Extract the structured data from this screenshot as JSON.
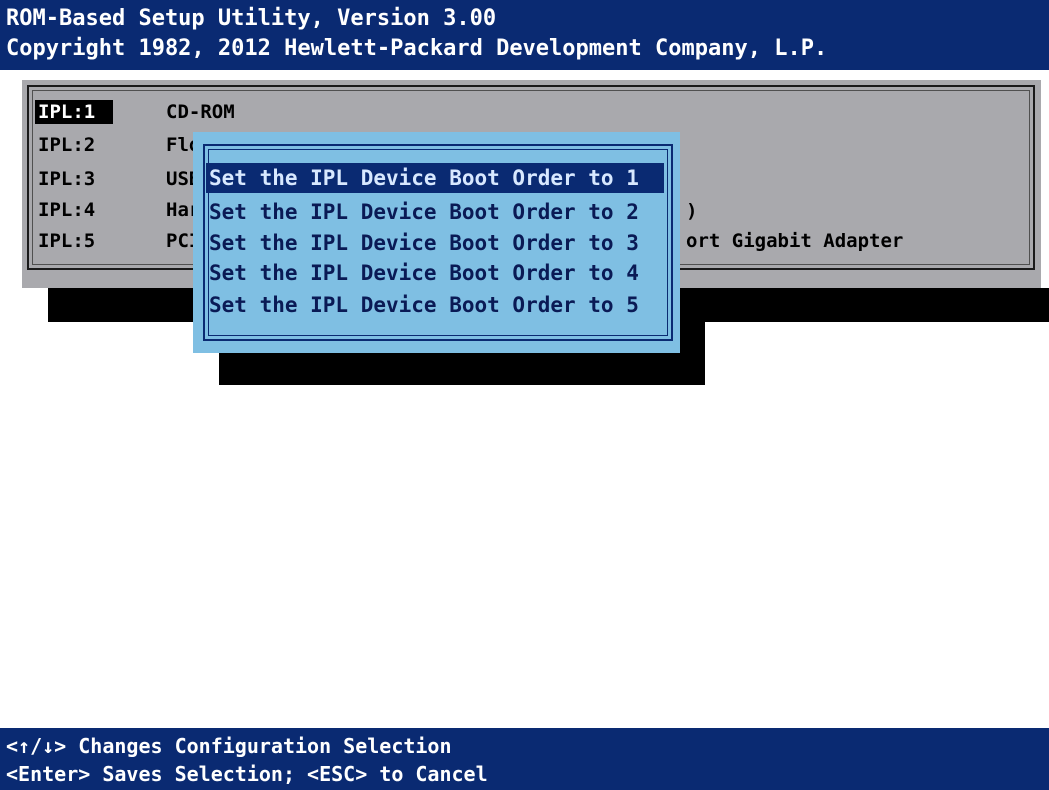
{
  "header": {
    "line1": "ROM-Based Setup Utility, Version 3.00",
    "line2": "Copyright 1982, 2012 Hewlett-Packard Development Company, L.P."
  },
  "ipl_list": [
    {
      "key": "IPL:1",
      "device": "CD-ROM"
    },
    {
      "key": "IPL:2",
      "device": "Flo"
    },
    {
      "key": "IPL:3",
      "device": "USB"
    },
    {
      "key": "IPL:4",
      "device": "Har"
    },
    {
      "key": "IPL:5",
      "device": "PCI"
    }
  ],
  "ipl_visible_tails": {
    "row4": ")",
    "row5": "ort Gigabit Adapter"
  },
  "popup": {
    "options": [
      "Set the IPL Device Boot Order to 1",
      "Set the IPL Device Boot Order to 2",
      "Set the IPL Device Boot Order to 3",
      "Set the IPL Device Boot Order to 4",
      "Set the IPL Device Boot Order to 5"
    ],
    "selected_index": 0
  },
  "footer": {
    "line1": "<↑/↓> Changes Configuration Selection",
    "line2": "<Enter> Saves Selection; <ESC> to Cancel"
  },
  "colors": {
    "header_bg": "#0a2a72",
    "panel_bg": "#a9a9ad",
    "popup_bg": "#7fbfe3",
    "highlight": "#0a2a72"
  }
}
